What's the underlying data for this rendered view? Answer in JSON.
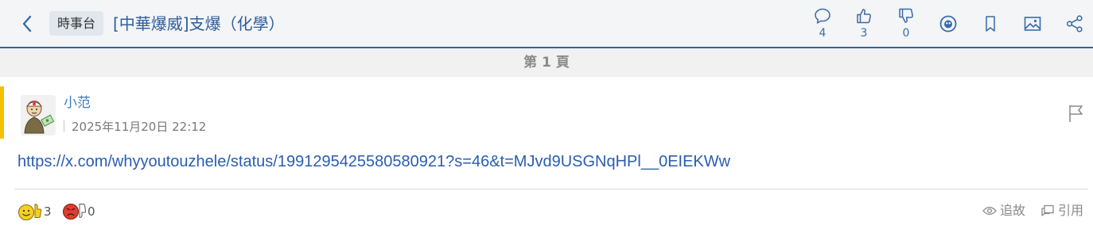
{
  "header": {
    "category": "時事台",
    "title": "[中華爆威]支爆（化學）",
    "stats": [
      {
        "icon": "comment-icon",
        "count": "4"
      },
      {
        "icon": "thumbs-up-icon",
        "count": "3"
      },
      {
        "icon": "thumbs-down-icon",
        "count": "0"
      }
    ],
    "tools": [
      "lihkg-face-icon",
      "bookmark-icon",
      "image-icon",
      "share-icon"
    ]
  },
  "page_indicator": "第 1 頁",
  "post": {
    "username": "小范",
    "timestamp": "2025年11月20日 22:12",
    "content_link": "https://x.com/whyyoutouzhele/status/1991295425580580921?s=46&t=MJvd9USGNqHPl__0EIEKWw",
    "likes": "3",
    "dislikes": "0",
    "actions": {
      "follow_label": "追故",
      "quote_label": "引用"
    }
  },
  "colors": {
    "accent_blue": "#2f5d9c",
    "link_blue": "#2a5db0",
    "username_blue": "#3c7fc0",
    "accent_yellow": "#f2c200"
  }
}
